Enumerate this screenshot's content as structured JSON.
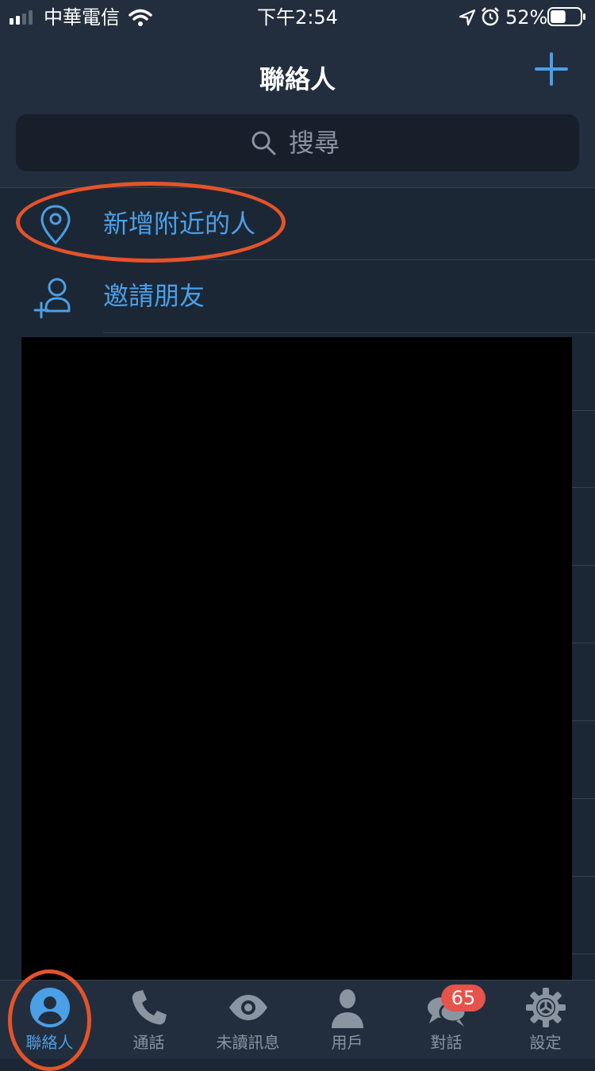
{
  "status_bar": {
    "carrier": "中華電信",
    "time": "下午2:54",
    "battery_percent": "52%",
    "battery_level": 0.52,
    "signal_bars": 2,
    "icons": [
      "signal-icon",
      "wifi-icon",
      "location-arrow-icon",
      "alarm-icon",
      "battery-icon"
    ]
  },
  "header": {
    "title": "聯絡人",
    "add_icon": "plus-icon"
  },
  "search": {
    "placeholder": "搜尋",
    "icon": "search-icon"
  },
  "actions": [
    {
      "label": "新增附近的人",
      "icon": "location-pin-icon"
    },
    {
      "label": "邀請朋友",
      "icon": "add-person-icon"
    }
  ],
  "tabbar": {
    "tabs": [
      {
        "label": "聯絡人",
        "icon": "contact-icon",
        "active": true
      },
      {
        "label": "通話",
        "icon": "phone-icon",
        "active": false
      },
      {
        "label": "未讀訊息",
        "icon": "eye-icon",
        "active": false
      },
      {
        "label": "用戶",
        "icon": "user-icon",
        "active": false
      },
      {
        "label": "對話",
        "icon": "chat-bubbles-icon",
        "active": false,
        "badge": "65"
      },
      {
        "label": "設定",
        "icon": "gear-icon",
        "active": false
      }
    ]
  },
  "colors": {
    "background": "#1c2735",
    "bar": "#222e3d",
    "accent": "#4b9fe6",
    "annotation": "#e5532a",
    "badge": "#e5534b"
  }
}
